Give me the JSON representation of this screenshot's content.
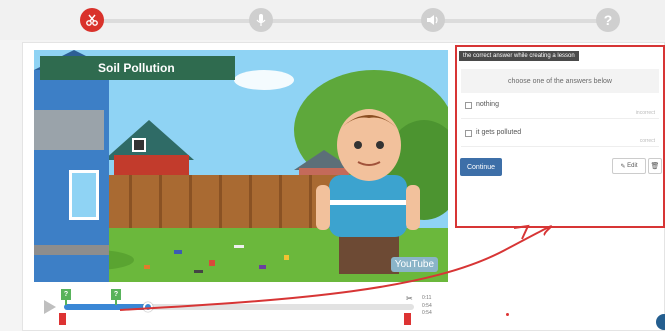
{
  "steps": {
    "items": [
      {
        "icon": "scissors-icon",
        "active": true
      },
      {
        "icon": "microphone-icon",
        "active": false
      },
      {
        "icon": "speaker-icon",
        "active": false
      },
      {
        "icon": "question-icon",
        "label": "?",
        "active": false
      }
    ]
  },
  "video": {
    "title": "Soil Pollution",
    "watermark": "YouTube"
  },
  "quiz": {
    "header": "the correct answer while creating a lesson",
    "prompt": "choose one of the answers below",
    "answers": [
      {
        "label": "nothing",
        "tag": "incorrect"
      },
      {
        "label": "it gets polluted",
        "tag": "correct"
      }
    ],
    "continue_label": "Continue",
    "edit_label": "Edit"
  },
  "timeline": {
    "markers": [
      "?",
      "?"
    ],
    "progress": 0.24,
    "current_time": "0:11",
    "duration": "0:54",
    "end_time": "0:54"
  },
  "colors": {
    "accent_red": "#d73535",
    "progress_blue": "#3a87d5",
    "marker_green": "#58b35b",
    "continue_blue": "#3d6fa8"
  }
}
